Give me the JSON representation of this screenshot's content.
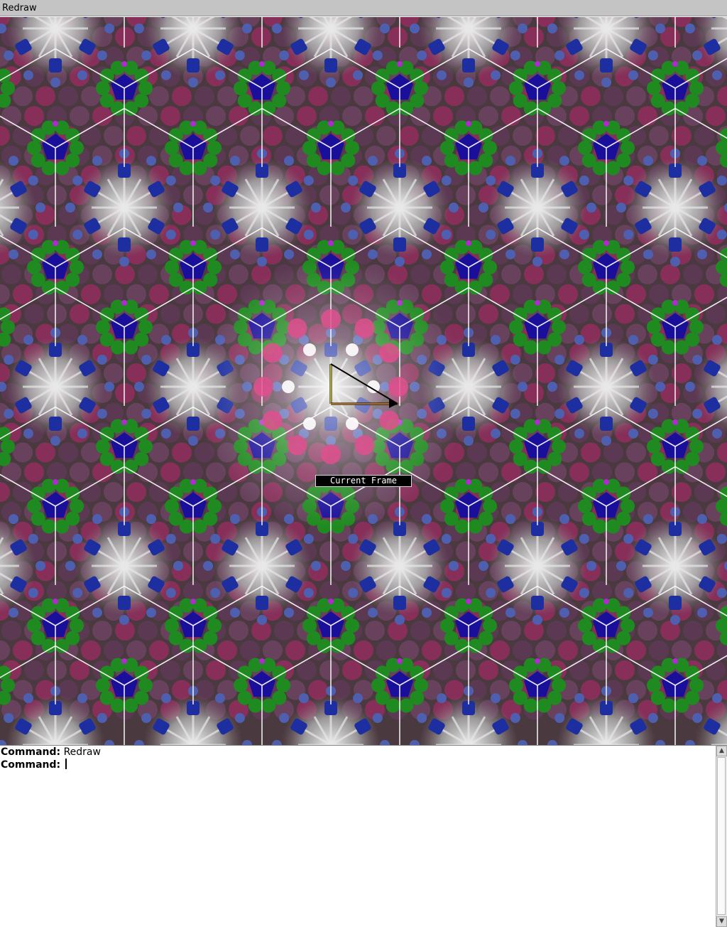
{
  "window": {
    "title": "Redraw"
  },
  "viewport": {
    "frame_label": "Current Frame",
    "colors": {
      "background": "#4a3a40",
      "magenta": "#8e2f5c",
      "green": "#1f8a1f",
      "blue": "#1c2ea0",
      "deep_blue": "#1a0f9a",
      "silver": "#c8c8c8",
      "grid_line": "#ffffff",
      "frame_x_axis": "#e08a1a",
      "frame_y_axis": "#e0e020"
    }
  },
  "console": {
    "lines": [
      {
        "prompt": "Command:",
        "text": "Redraw"
      },
      {
        "prompt": "Command:",
        "text": ""
      }
    ]
  }
}
